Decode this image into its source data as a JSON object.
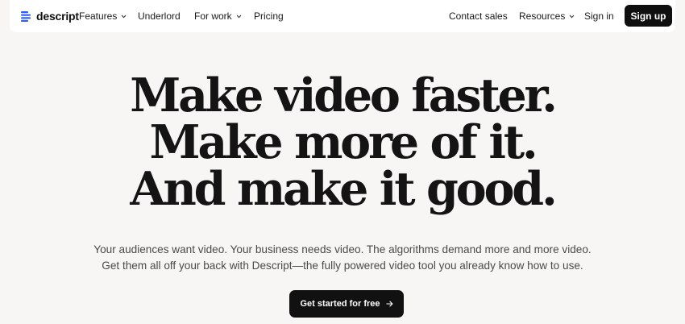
{
  "brand": {
    "name": "descript",
    "logo_icon": "descript-logo-icon",
    "logo_color": "#2f5cff"
  },
  "nav": {
    "left": [
      {
        "label": "Features",
        "dropdown": true
      },
      {
        "label": "Underlord",
        "dropdown": false
      },
      {
        "label": "For work",
        "dropdown": true
      },
      {
        "label": "Pricing",
        "dropdown": false
      }
    ],
    "right": [
      {
        "label": "Contact sales",
        "dropdown": false
      },
      {
        "label": "Resources",
        "dropdown": true
      },
      {
        "label": "Sign in",
        "dropdown": false
      }
    ],
    "signup_label": "Sign up"
  },
  "hero": {
    "lines": [
      "Make video faster.",
      "Make more of it.",
      "And make it good."
    ]
  },
  "subhead": {
    "lines": [
      "Your audiences want video. Your business needs video. The algorithms demand more and more video.",
      "Get them all off your back with Descript—the fully powered video tool you already know how to use."
    ]
  },
  "cta": {
    "label": "Get started for free",
    "icon": "arrow-right-icon"
  },
  "colors": {
    "background": "#f7f6f4",
    "nav_bg": "#ffffff",
    "button_bg": "#111111",
    "button_text": "#ffffff"
  }
}
